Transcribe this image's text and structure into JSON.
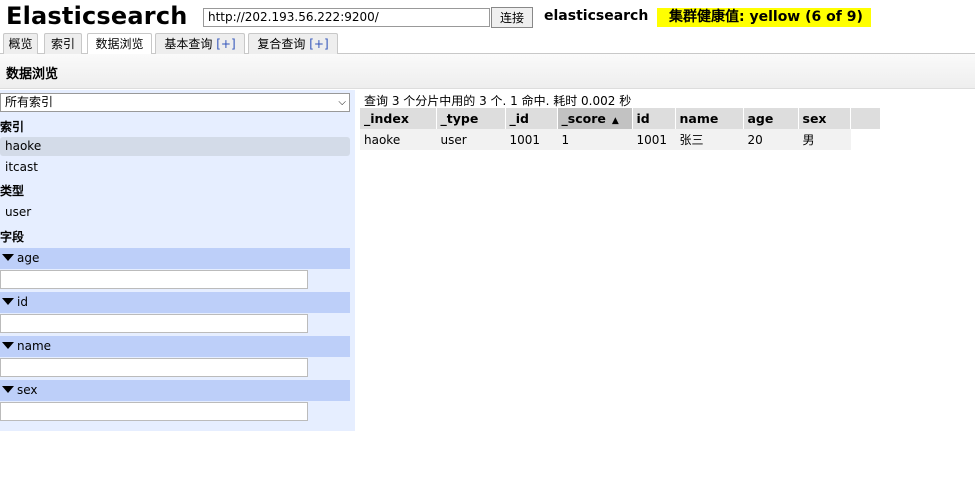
{
  "header": {
    "title": "Elasticsearch",
    "url_value": "http://202.193.56.222:9200/",
    "connect_label": "连接",
    "cluster_name": "elasticsearch",
    "health": "集群健康值: yellow (6 of 9)"
  },
  "colors": {
    "health_bg": "#ffff00",
    "sidebar_bg": "#e6eeff",
    "field_header_bg": "#bdcff9"
  },
  "tabs": [
    {
      "label": "概览"
    },
    {
      "label": "索引"
    },
    {
      "label": "数据浏览",
      "active": true
    },
    {
      "label": "基本查询",
      "plus": "[+]"
    },
    {
      "label": "复合查询",
      "plus": "[+]"
    }
  ],
  "section": {
    "title": "数据浏览"
  },
  "sidebar": {
    "index_select": "所有索引",
    "index_label": "索引",
    "indices": [
      "haoke",
      "itcast"
    ],
    "type_label": "类型",
    "types": [
      "user"
    ],
    "field_label": "字段",
    "fields": [
      "age",
      "id",
      "name",
      "sex"
    ]
  },
  "results": {
    "summary": "查询 3 个分片中用的 3 个. 1 命中. 耗时 0.002 秒",
    "columns": [
      "_index",
      "_type",
      "_id",
      "_score",
      "id",
      "name",
      "age",
      "sex"
    ],
    "sorted_column": "_score",
    "rows": [
      [
        "haoke",
        "user",
        "1001",
        "1",
        "1001",
        "张三",
        "20",
        "男"
      ]
    ]
  },
  "icons": {
    "sort": "sort-ascending-icon",
    "expand": "triangle-down-icon",
    "select": "chevron-down-icon"
  }
}
